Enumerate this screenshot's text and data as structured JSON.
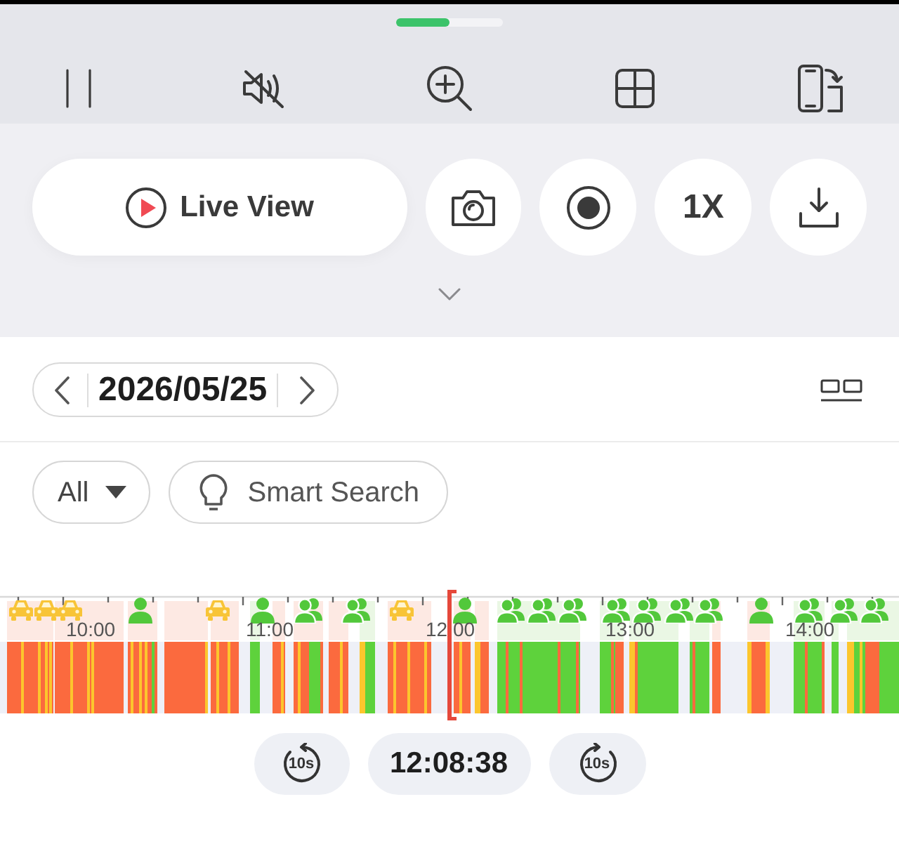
{
  "toolbar": {
    "muted": true
  },
  "actions": {
    "live_view": "Live View",
    "speed": "1X"
  },
  "date_picker": {
    "date": "2026/05/25"
  },
  "filters": {
    "event_type": "All",
    "smart_search": "Smart Search"
  },
  "timeline": {
    "hour_labels": [
      "10:00",
      "11:00",
      "12:00",
      "13:00",
      "14:00"
    ]
  },
  "playback": {
    "rewind_label": "10s",
    "current_time": "12:08:38",
    "forward_label": "10s"
  }
}
